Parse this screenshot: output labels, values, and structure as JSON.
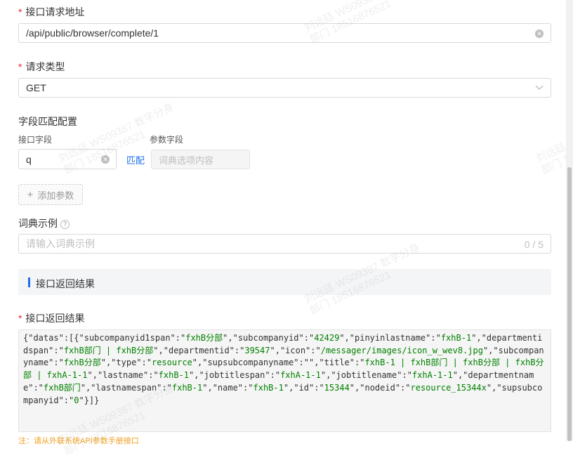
{
  "api_url": {
    "label": "接口请求地址",
    "value": "/api/public/browser/complete/1"
  },
  "request_type": {
    "label": "请求类型",
    "value": "GET"
  },
  "field_mapping": {
    "title": "字段匹配配置",
    "col_api_field": "接口字段",
    "col_param_field": "参数字段",
    "api_field_value": "q",
    "match_link": "匹配",
    "param_placeholder": "词典选项内容"
  },
  "add_param": {
    "icon": "+",
    "label": "添加参数"
  },
  "dict_example": {
    "label": "词典示例",
    "placeholder": "请输入词典示例",
    "counter": "0 / 5"
  },
  "section": {
    "title": "接口返回结果"
  },
  "result": {
    "label": "接口返回结果",
    "json_text": "{\"datas\":[{\"subcompanyid1span\":\"fxhB分部\",\"subcompanyid\":\"42429\",\"pinyinlastname\":\"fxhB-1\",\"departmentidspan\":\"fxhB部门 | fxhB分部\",\"departmentid\":\"39547\",\"icon\":\"/messager/images/icon_w_wev8.jpg\",\"subcompanyname\":\"fxhB分部\",\"type\":\"resource\",\"supsubcompanyname\":\"\",\"title\":\"fxhB-1 | fxhB部门 | fxhB分部 | fxhB分部 | fxhA-1-1\",\"lastname\":\"fxhB-1\",\"jobtitlespan\":\"fxhA-1-1\",\"jobtitlename\":\"fxhA-1-1\",\"departmentname\":\"fxhB部门\",\"lastnamespan\":\"fxhB-1\",\"name\":\"fxhB-1\",\"id\":\"15344\",\"nodeid\":\"resource_15344x\",\"supsubcompanyid\":\"0\"}]}"
  },
  "note": "注：请从外联系统API参数手册接口",
  "watermark": {
    "line1": "刘远廷 WS09387 数字分身",
    "line2": "部门 18516876521"
  },
  "colors": {
    "required": "#f5222d",
    "accent": "#1f6feb",
    "string_value": "#008000"
  }
}
